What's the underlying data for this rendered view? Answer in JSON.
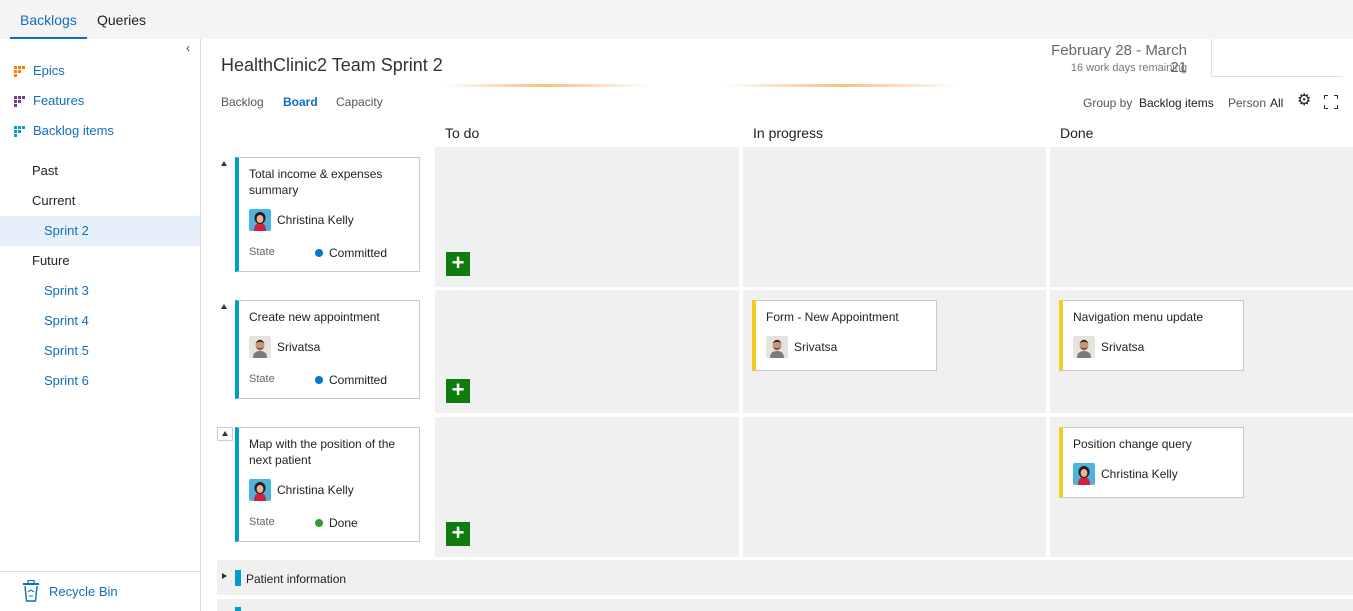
{
  "topnav": {
    "tabs": [
      {
        "label": "Backlogs",
        "active": true
      },
      {
        "label": "Queries",
        "active": false
      }
    ]
  },
  "sidebar": {
    "backlogs": [
      {
        "label": "Epics",
        "color": "#ff7b00"
      },
      {
        "label": "Features",
        "color": "#773b93"
      },
      {
        "label": "Backlog items",
        "color": "#009ccc"
      }
    ],
    "iterations": [
      {
        "label": "Past",
        "level": 0
      },
      {
        "label": "Current",
        "level": 0
      },
      {
        "label": "Sprint 2",
        "level": 1,
        "selected": true
      },
      {
        "label": "Future",
        "level": 0
      },
      {
        "label": "Sprint 3",
        "level": 1
      },
      {
        "label": "Sprint 4",
        "level": 1
      },
      {
        "label": "Sprint 5",
        "level": 1
      },
      {
        "label": "Sprint 6",
        "level": 1
      }
    ],
    "recycle_bin": "Recycle Bin"
  },
  "header": {
    "title": "HealthClinic2 Team Sprint 2",
    "date_range": "February 28 - March 21",
    "days_remaining": "16 work days remaining",
    "tabs": [
      {
        "label": "Backlog",
        "active": false
      },
      {
        "label": "Board",
        "active": true
      },
      {
        "label": "Capacity",
        "active": false
      }
    ],
    "group_by_label": "Group by",
    "group_by_value": "Backlog items",
    "person_label": "Person",
    "person_value": "All"
  },
  "board": {
    "columns": [
      "To do",
      "In progress",
      "Done"
    ],
    "rows": [
      {
        "parent": {
          "title": "Total income & expenses summary",
          "assignee": "Christina Kelly",
          "state_label": "State",
          "state": "Committed",
          "state_color": "#007acc"
        },
        "in_progress": [],
        "done": []
      },
      {
        "parent": {
          "title": "Create new appointment",
          "assignee": "Srivatsa",
          "state_label": "State",
          "state": "Committed",
          "state_color": "#007acc"
        },
        "in_progress": [
          {
            "title": "Form - New Appointment",
            "assignee": "Srivatsa"
          }
        ],
        "done": [
          {
            "title": "Navigation menu update",
            "assignee": "Srivatsa"
          }
        ]
      },
      {
        "parent": {
          "title": "Map with the position of the next patient",
          "assignee": "Christina Kelly",
          "state_label": "State",
          "state": "Done",
          "state_color": "#339933"
        },
        "in_progress": [],
        "done": [
          {
            "title": "Position change query",
            "assignee": "Christina Kelly"
          }
        ]
      }
    ],
    "collapsed_rows": [
      {
        "title": "Patient information"
      }
    ]
  }
}
